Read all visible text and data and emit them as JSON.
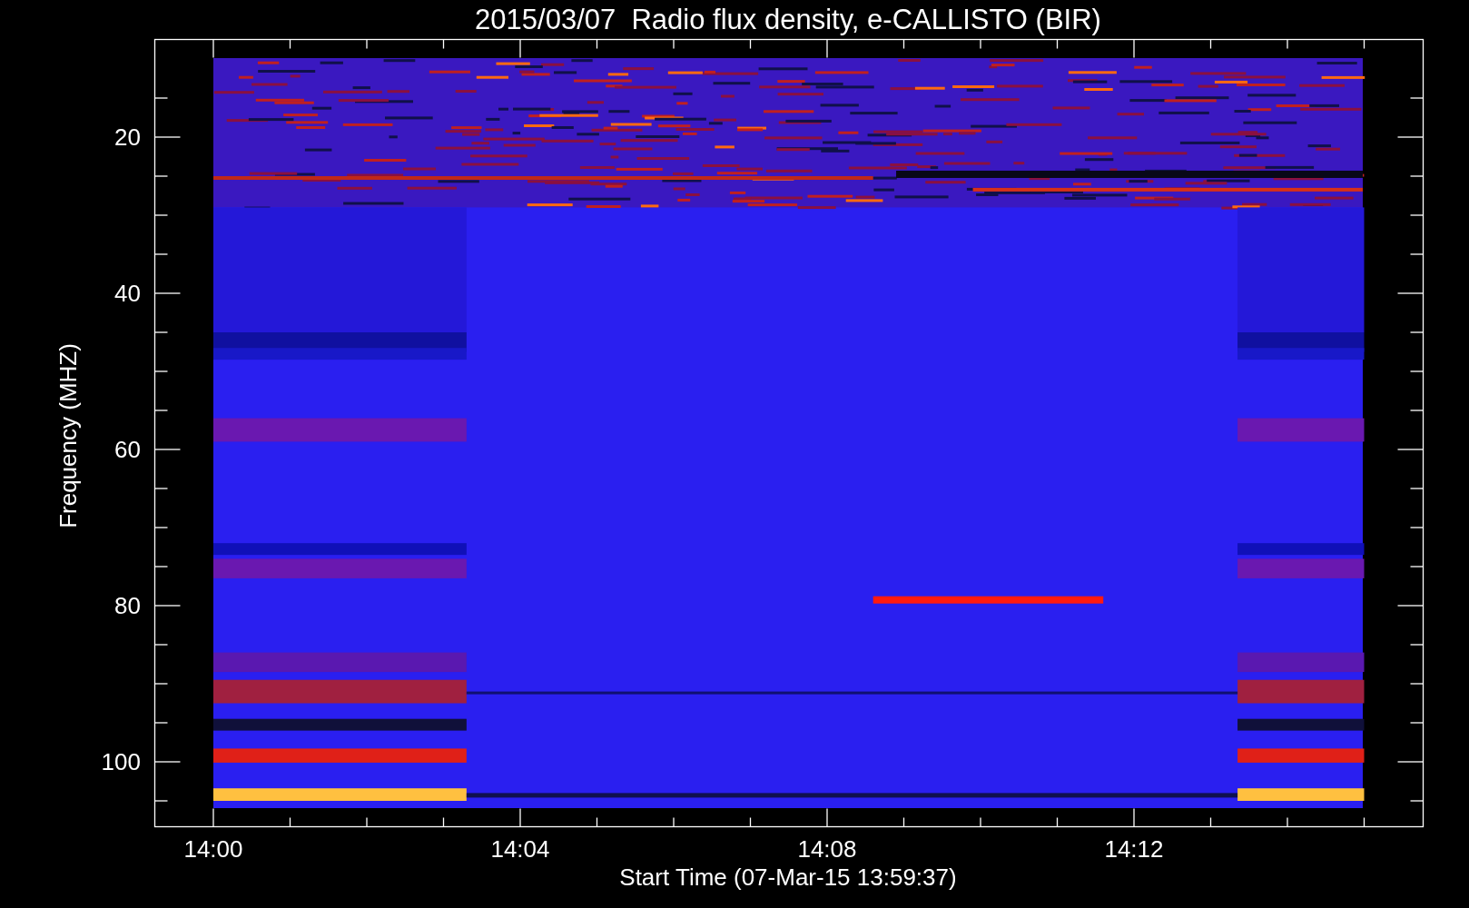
{
  "title": "2015/03/07  Radio flux density, e-CALLISTO (BIR)",
  "y_axis": {
    "label": "Frequency (MHZ)",
    "ticks": [
      "20",
      "40",
      "60",
      "80",
      "100"
    ]
  },
  "x_axis": {
    "label": "Start Time (07-Mar-15 13:59:37)",
    "ticks": [
      "14:00",
      "14:04",
      "14:08",
      "14:12"
    ]
  }
}
